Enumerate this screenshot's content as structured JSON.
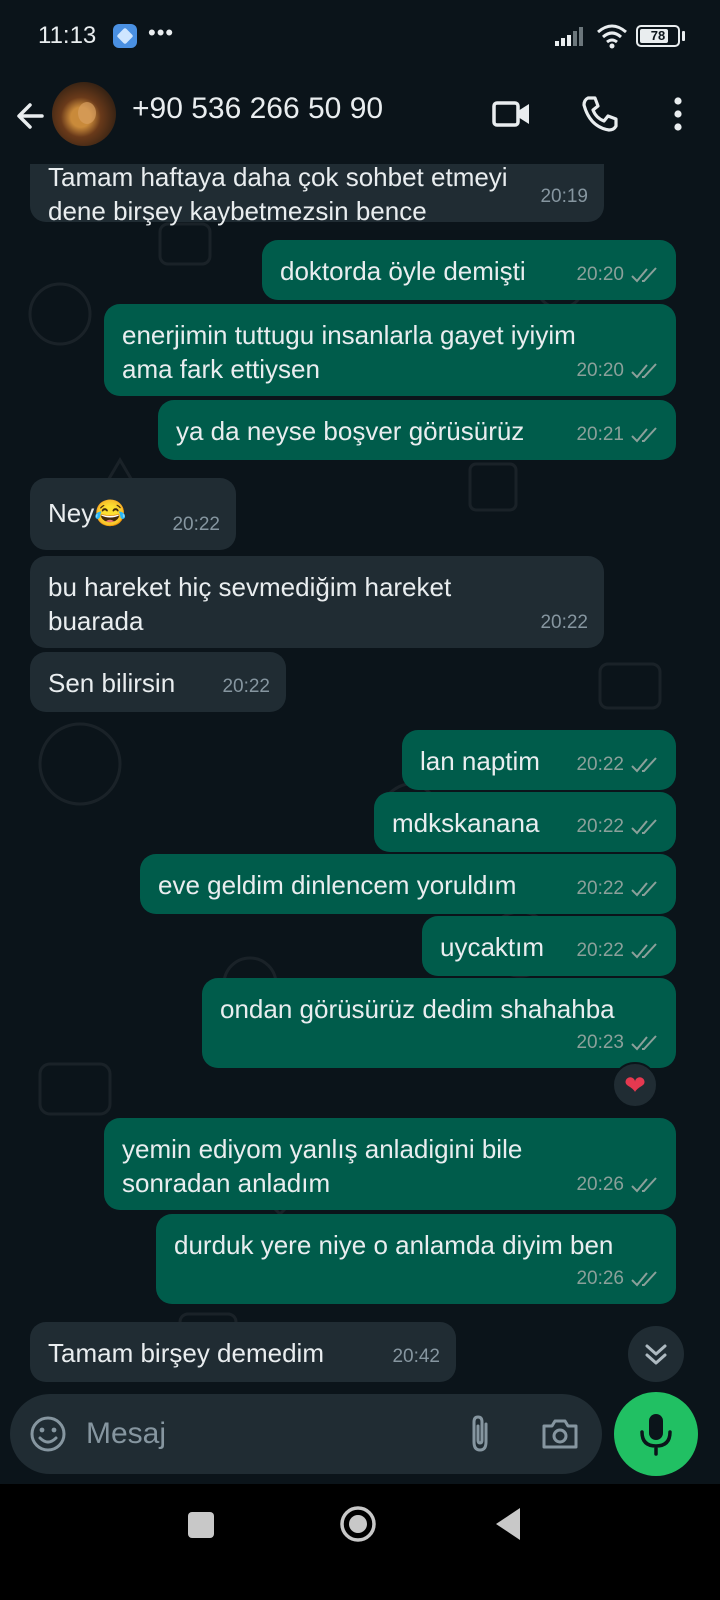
{
  "status_bar": {
    "time": "11:13",
    "more": "•••",
    "battery": "78",
    "battery_level": 0.78
  },
  "header": {
    "contact_name": "+90 536 266 50 90",
    "icons": [
      "back-arrow-icon",
      "video-call-icon",
      "voice-call-icon",
      "more-vertical-icon"
    ]
  },
  "messages": [
    {
      "dir": "in",
      "text": "Tamam haftaya daha çok sohbet etmeyi\ndene birşey kaybetmezsin bence",
      "time": "20:19"
    },
    {
      "dir": "out",
      "text": "doktorda öyle demişti",
      "time": "20:20",
      "status": "read"
    },
    {
      "dir": "out",
      "text": "enerjimin tuttugu insanlarla gayet iyiyim\nama fark ettiysen",
      "time": "20:20",
      "status": "read"
    },
    {
      "dir": "out",
      "text": "ya da neyse boşver görüsürüz",
      "time": "20:21",
      "status": "read"
    },
    {
      "dir": "in",
      "text": "Ney😂",
      "time": "20:22"
    },
    {
      "dir": "in",
      "text": "bu hareket hiç sevmediğim hareket\nbuarada",
      "time": "20:22"
    },
    {
      "dir": "in",
      "text": "Sen bilirsin",
      "time": "20:22"
    },
    {
      "dir": "out",
      "text": "lan naptim",
      "time": "20:22",
      "status": "read"
    },
    {
      "dir": "out",
      "text": "mdkskanana",
      "time": "20:22",
      "status": "read"
    },
    {
      "dir": "out",
      "text": "eve geldim dinlencem yoruldım",
      "time": "20:22",
      "status": "read"
    },
    {
      "dir": "out",
      "text": "uycaktım",
      "time": "20:22",
      "status": "read"
    },
    {
      "dir": "out",
      "text": "ondan görüsürüz dedim shahahba",
      "time": "20:23",
      "status": "read"
    },
    {
      "dir": "out",
      "text": "yemin ediyom yanlış anladigini bile\nsonradan anladım",
      "time": "20:26",
      "status": "read"
    },
    {
      "dir": "out",
      "text": "durduk yere niye o anlamda diyim ben",
      "time": "20:26",
      "status": "read"
    },
    {
      "dir": "in",
      "text": "Tamam birşey demedim",
      "time": "20:42"
    }
  ],
  "reaction": {
    "emoji": "❤",
    "color": "#e53950"
  },
  "composer": {
    "placeholder": "Mesaj",
    "value": ""
  },
  "colors": {
    "background": "#0b141a",
    "incoming_bubble": "#202c33",
    "outgoing_bubble": "#005c4b",
    "mic_button": "#21c063"
  }
}
